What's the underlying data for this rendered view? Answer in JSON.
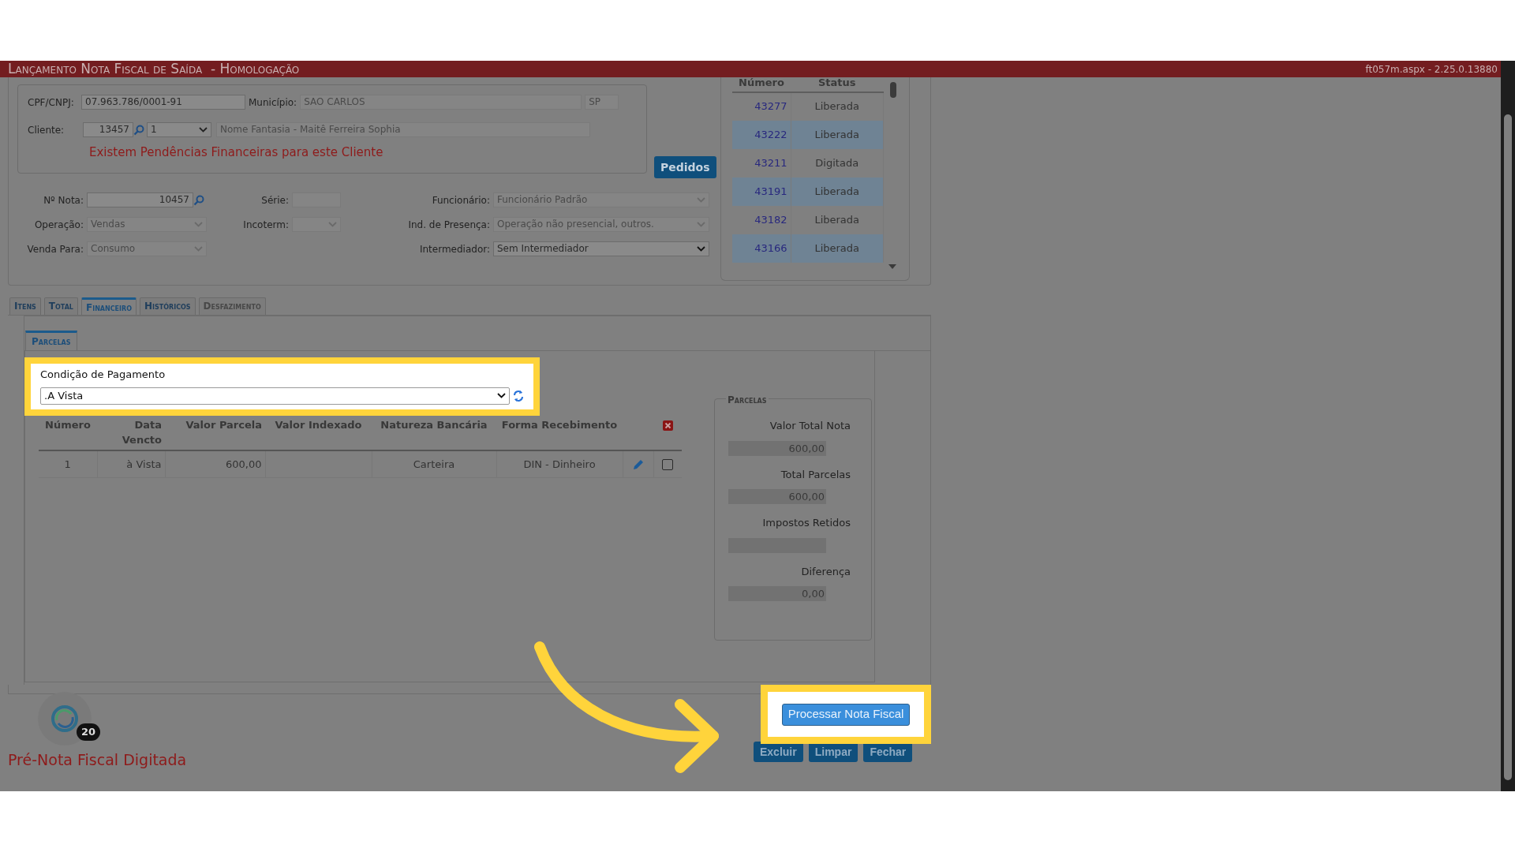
{
  "header": {
    "title": "Lançamento Nota Fiscal de Saída  - Homologação",
    "version": "ft057m.aspx - 2.25.0.13880"
  },
  "client": {
    "cpf_label": "CPF/CNPJ:",
    "cpf": "07.963.786/0001-91",
    "city_label": "Município:",
    "city": "SAO CARLOS",
    "state": "SP",
    "client_label": "Cliente:",
    "client_code": "13457",
    "client_select": "1",
    "trade_name": "Nome Fantasia - Maitê Ferreira Sophia",
    "warning": "Existem Pendências Financeiras para este Cliente"
  },
  "pedidos_button": "Pedidos",
  "orders": {
    "columns": [
      "Número",
      "Status"
    ],
    "rows": [
      {
        "number": "43277",
        "status": "Liberada"
      },
      {
        "number": "43222",
        "status": "Liberada"
      },
      {
        "number": "43211",
        "status": "Digitada"
      },
      {
        "number": "43191",
        "status": "Liberada"
      },
      {
        "number": "43182",
        "status": "Liberada"
      },
      {
        "number": "43166",
        "status": "Liberada"
      }
    ]
  },
  "form": [
    {
      "label": "Nº Nota:",
      "kind": "input",
      "value": "10457",
      "search": true,
      "disabled": false
    },
    {
      "label": "Série:",
      "kind": "input",
      "disabled": true
    },
    {
      "label": "Funcionário:",
      "kind": "select",
      "value": "Funcionário Padrão",
      "disabled": true
    },
    {
      "label": "Operação:",
      "kind": "select",
      "value": "Vendas",
      "disabled": true
    },
    {
      "label": "Incoterm:",
      "kind": "select",
      "disabled": true
    },
    {
      "label": "Ind. de Presença:",
      "kind": "select",
      "value": "Operação não presencial, outros.",
      "disabled": true
    },
    {
      "label": "Venda Para:",
      "kind": "select",
      "value": "Consumo",
      "disabled": true
    },
    {
      "label": "Intermediador:",
      "kind": "select",
      "value": "Sem Intermediador",
      "disabled": false
    }
  ],
  "tabs": [
    {
      "label": "Itens",
      "selected": false,
      "disabled": false
    },
    {
      "label": "Total",
      "selected": false,
      "disabled": false
    },
    {
      "label": "Financeiro",
      "selected": true,
      "disabled": false
    },
    {
      "label": "Históricos",
      "selected": false,
      "disabled": false
    },
    {
      "label": "Desfazimento",
      "selected": false,
      "disabled": true
    }
  ],
  "subtabs": [
    {
      "label": "Parcelas",
      "selected": true
    }
  ],
  "payment_condition": {
    "label": "Condição de Pagamento",
    "value": ".A Vista"
  },
  "installments": {
    "columns": [
      "Número",
      "Data Vencto",
      "Valor Parcela",
      "Valor Indexado",
      "Natureza Bancária",
      "Forma Recebimento"
    ],
    "rows": [
      {
        "cells": [
          "1",
          "à Vista",
          "600,00",
          "",
          "Carteira",
          "DIN - Dinheiro"
        ],
        "checked": false
      }
    ]
  },
  "summary": {
    "title": "Parcelas",
    "fields": [
      {
        "label": "Valor Total Nota",
        "value": "600,00"
      },
      {
        "label": "Total Parcelas",
        "value": "600,00"
      },
      {
        "label": "Impostos Retidos"
      },
      {
        "label": "Diferença",
        "value": "0,00"
      }
    ]
  },
  "process_button": "Processar Nota Fiscal",
  "actions": [
    "Excluir",
    "Limpar",
    "Fechar"
  ],
  "status_text": "Pré-Nota Fiscal Digitada",
  "notification_count": "20"
}
